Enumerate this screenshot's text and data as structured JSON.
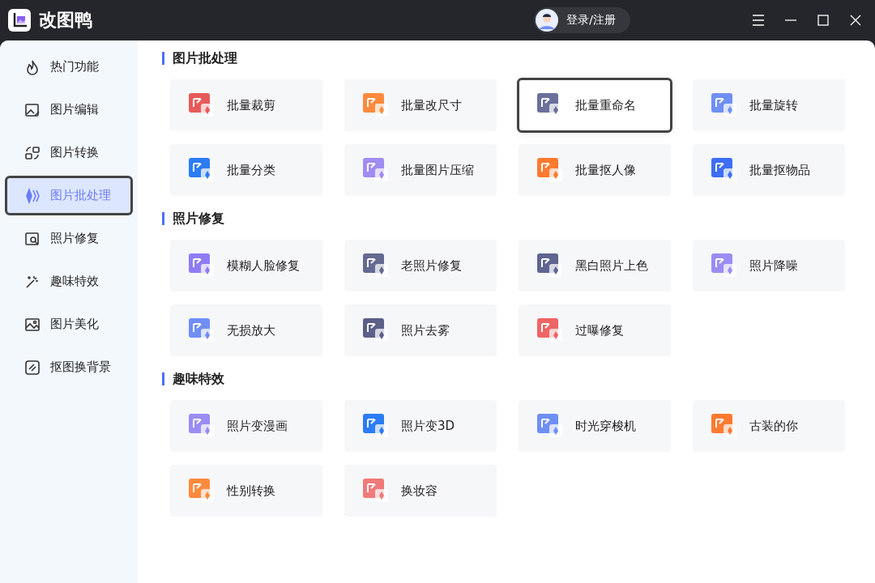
{
  "app": {
    "title": "改图鸭",
    "login": "登录/注册"
  },
  "sidebar": {
    "items": [
      {
        "label": "热门功能",
        "selected": false,
        "focused": false
      },
      {
        "label": "图片编辑",
        "selected": false,
        "focused": false
      },
      {
        "label": "图片转换",
        "selected": false,
        "focused": false
      },
      {
        "label": "图片批处理",
        "selected": true,
        "focused": true
      },
      {
        "label": "照片修复",
        "selected": false,
        "focused": false
      },
      {
        "label": "趣味特效",
        "selected": false,
        "focused": false
      },
      {
        "label": "图片美化",
        "selected": false,
        "focused": false
      },
      {
        "label": "抠图换背景",
        "selected": false,
        "focused": false
      }
    ]
  },
  "sections": [
    {
      "title": "图片批处理",
      "tools": [
        {
          "label": "批量裁剪",
          "color": "#e85a5a",
          "focused": false
        },
        {
          "label": "批量改尺寸",
          "color": "#ff8a3d",
          "focused": false
        },
        {
          "label": "批量重命名",
          "color": "#6b6f9a",
          "focused": true
        },
        {
          "label": "批量旋转",
          "color": "#6f8ff5",
          "focused": false
        },
        {
          "label": "批量分类",
          "color": "#2b7cf6",
          "focused": false
        },
        {
          "label": "批量图片压缩",
          "color": "#a08cf2",
          "focused": false
        },
        {
          "label": "批量抠人像",
          "color": "#ff7a30",
          "focused": false
        },
        {
          "label": "批量抠物品",
          "color": "#3d6ef5",
          "focused": false
        }
      ]
    },
    {
      "title": "照片修复",
      "tools": [
        {
          "label": "模糊人脸修复",
          "color": "#8f7cf5",
          "focused": false
        },
        {
          "label": "老照片修复",
          "color": "#646a91",
          "focused": false
        },
        {
          "label": "黑白照片上色",
          "color": "#5f6490",
          "focused": false
        },
        {
          "label": "照片降噪",
          "color": "#9b8cf3",
          "focused": false
        },
        {
          "label": "无损放大",
          "color": "#6f8ff5",
          "focused": false
        },
        {
          "label": "照片去雾",
          "color": "#5b6088",
          "focused": false
        },
        {
          "label": "过曝修复",
          "color": "#f06464",
          "focused": false
        }
      ]
    },
    {
      "title": "趣味特效",
      "tools": [
        {
          "label": "照片变漫画",
          "color": "#9a8cf4",
          "focused": false
        },
        {
          "label": "照片变3D",
          "color": "#2b7cf6",
          "focused": false
        },
        {
          "label": "时光穿梭机",
          "color": "#6f8ff5",
          "focused": false
        },
        {
          "label": "古装的你",
          "color": "#ff7a30",
          "focused": false
        },
        {
          "label": "性别转换",
          "color": "#ff8a3d",
          "focused": false
        },
        {
          "label": "换妆容",
          "color": "#f07a7a",
          "focused": false
        }
      ]
    }
  ]
}
